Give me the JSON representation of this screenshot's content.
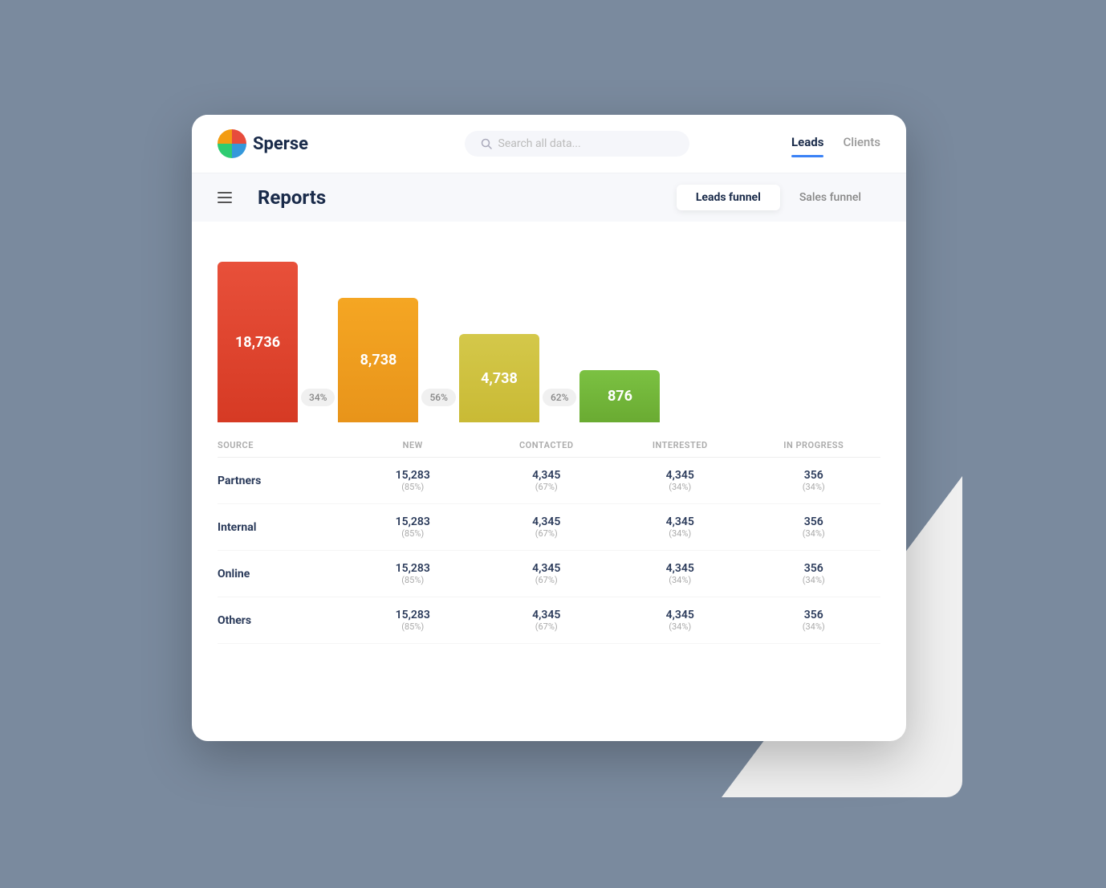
{
  "app": {
    "logo_text": "Sperse"
  },
  "header": {
    "search_placeholder": "Search all data...",
    "nav_tabs": [
      {
        "id": "leads",
        "label": "Leads",
        "active": true
      },
      {
        "id": "clients",
        "label": "Clients",
        "active": false
      }
    ]
  },
  "sub_header": {
    "page_title": "Reports",
    "funnel_tabs": [
      {
        "id": "leads-funnel",
        "label": "Leads funnel",
        "active": true
      },
      {
        "id": "sales-funnel",
        "label": "Sales funnel",
        "active": false
      }
    ]
  },
  "chart": {
    "bars": [
      {
        "id": "new",
        "value": "18,736",
        "color_class": "bar-new",
        "pct_after": "34%"
      },
      {
        "id": "contacted",
        "value": "8,738",
        "color_class": "bar-contacted",
        "pct_after": "56%"
      },
      {
        "id": "interested",
        "value": "4,738",
        "color_class": "bar-interested",
        "pct_after": "62%"
      },
      {
        "id": "inprogress",
        "value": "876",
        "color_class": "bar-inprogress",
        "pct_after": null
      }
    ]
  },
  "table": {
    "col_headers": [
      "Source",
      "NEW",
      "CONTACTED",
      "INTERESTED",
      "IN PROGRESS"
    ],
    "rows": [
      {
        "source": "Partners",
        "new": "15,283",
        "new_pct": "(85%)",
        "contacted": "4,345",
        "contacted_pct": "(67%)",
        "interested": "4,345",
        "interested_pct": "(34%)",
        "inprogress": "356",
        "inprogress_pct": "(34%)"
      },
      {
        "source": "Internal",
        "new": "15,283",
        "new_pct": "(85%)",
        "contacted": "4,345",
        "contacted_pct": "(67%)",
        "interested": "4,345",
        "interested_pct": "(34%)",
        "inprogress": "356",
        "inprogress_pct": "(34%)"
      },
      {
        "source": "Online",
        "new": "15,283",
        "new_pct": "(85%)",
        "contacted": "4,345",
        "contacted_pct": "(67%)",
        "interested": "4,345",
        "interested_pct": "(34%)",
        "inprogress": "356",
        "inprogress_pct": "(34%)"
      },
      {
        "source": "Others",
        "new": "15,283",
        "new_pct": "(85%)",
        "contacted": "4,345",
        "contacted_pct": "(67%)",
        "interested": "4,345",
        "interested_pct": "(34%)",
        "inprogress": "356",
        "inprogress_pct": "(34%)"
      }
    ]
  }
}
